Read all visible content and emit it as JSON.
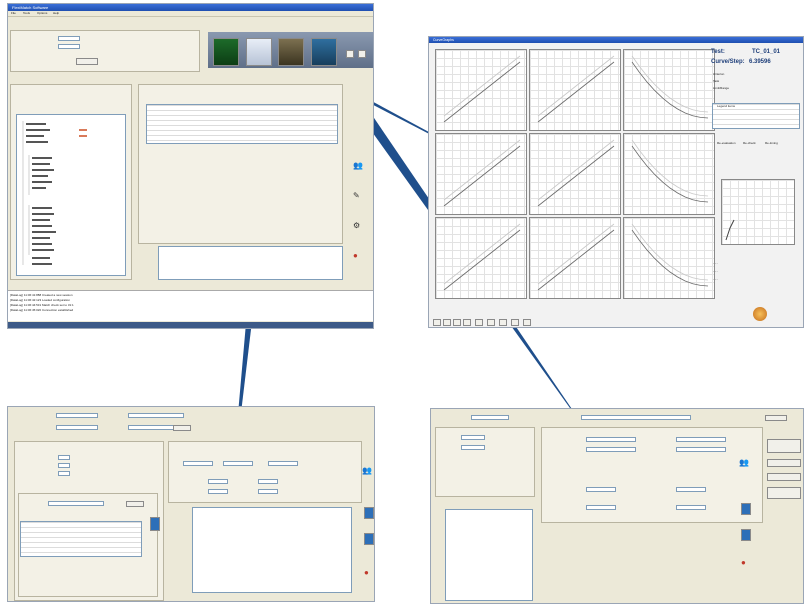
{
  "main_window": {
    "title": "FlexiMatch Software",
    "menu": [
      "File",
      "Tools",
      "Options",
      "Help"
    ],
    "log_lines": [
      "[DataLog] 11:06:41:888 Created a new session",
      "[DataLog] 11:06:42:123 Loaded configuration",
      "[DataLog] 11:06:44:531 Match check set to 31:1",
      "[DataLog] 11:06:45:020 Connection established"
    ],
    "toolbar_buttons": [
      "modules-icon",
      "device-icon",
      "match-icon",
      "monitor-icon"
    ]
  },
  "plot_window": {
    "title": "CurveGraphs",
    "header_labels": [
      "Test:",
      "Curve/Step:"
    ],
    "header_values": [
      "TC_01_01",
      "6.39596"
    ],
    "rows": [
      "Criterion",
      "Task",
      "Limit/Range"
    ],
    "legend_title": "Legend items",
    "result_labels": [
      "Re-evaluation",
      "Re-check",
      "Re-timing"
    ],
    "nav_buttons": [
      "first-icon",
      "prev-icon",
      "next-icon",
      "last-icon",
      "zoom-icon",
      "export-icon",
      "save-icon",
      "print-icon",
      "refresh-icon"
    ],
    "curve_colors": [
      "#c8c8c8",
      "#6a6a6a"
    ],
    "trend": [
      "up",
      "up",
      "down",
      "up",
      "up",
      "down",
      "up",
      "up",
      "down"
    ]
  },
  "dialog_a": {
    "labels": [
      "Part Number:",
      "Material:",
      "Test Type:",
      "Operator:",
      "Comments"
    ],
    "buttons": [
      "Start",
      "Stop",
      "Exit"
    ]
  },
  "dialog_b": {
    "labels": [
      "Sample ID:",
      "Reference:",
      "Name:",
      "Status:",
      "Notes"
    ],
    "buttons": [
      "Start",
      "Save",
      "Exit"
    ]
  },
  "arrow_color": "#1f4f8c"
}
